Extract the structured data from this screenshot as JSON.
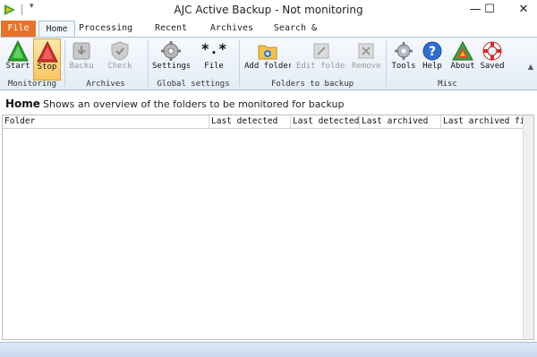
{
  "window": {
    "title": "AJC Active Backup - Not monitoring",
    "minimize_glyph": "—",
    "maximize_glyph": "☐",
    "close_glyph": "✕"
  },
  "ribbon_tabs": [
    {
      "label": "File"
    },
    {
      "label": "Home"
    },
    {
      "label": "Processing"
    },
    {
      "label": "Recent files"
    },
    {
      "label": "Archives"
    },
    {
      "label": "Search & list"
    }
  ],
  "ribbon": {
    "start_label": "Start",
    "stop_label": "Stop",
    "backup_now_label": "Backu",
    "check_integrity_label": "Check",
    "settings_label": "Settings",
    "file_patterns_label": "File",
    "add_folder_label": "Add folder",
    "edit_folder_label": "Edit folder",
    "remove_folder_label": "Remove",
    "tools_label": "Tools",
    "help_label": "Help",
    "about_label": "About",
    "saved_label": "Saved",
    "groups": {
      "monitoring": "Monitoring",
      "archives": "Archives",
      "global_settings": "Global settings",
      "folders_to_backup": "Folders to backup",
      "misc": "Misc"
    },
    "file_patterns_icon_text": "*.*"
  },
  "page": {
    "title": "Home",
    "description": "Shows an overview of the folders to be monitored for backup"
  },
  "table": {
    "columns": [
      "Folder",
      "Last detected",
      "Last detected",
      "Last archived",
      "Last archived file"
    ]
  },
  "colors": {
    "file_tab": "#e8722a",
    "ribbon_border": "#a8c0dd",
    "stop_highlight": "#f9c660"
  }
}
